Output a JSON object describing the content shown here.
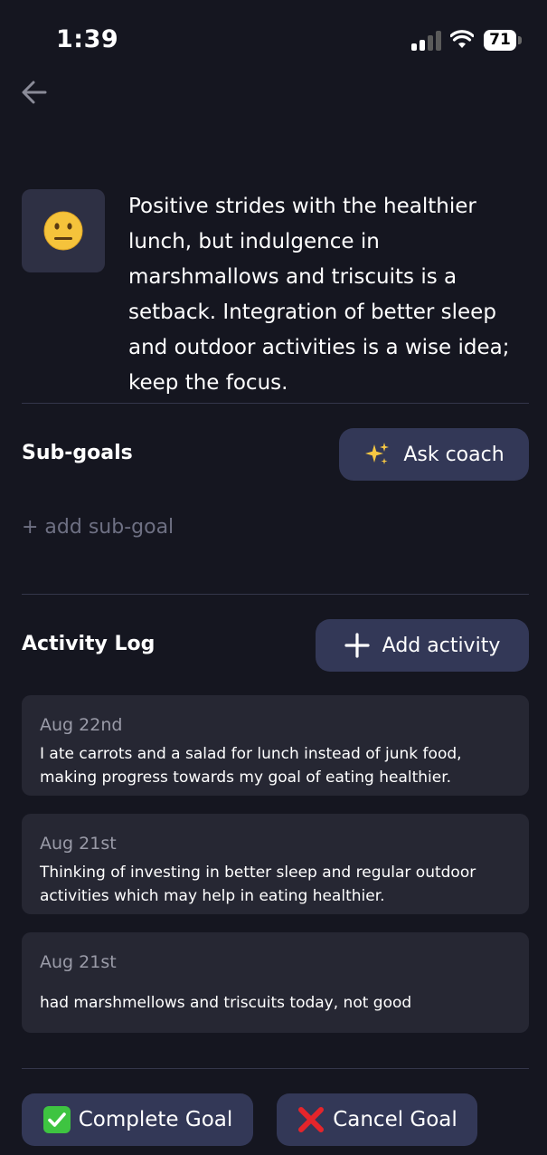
{
  "status_bar": {
    "time": "1:39",
    "battery": "71"
  },
  "summary": {
    "emoji": "neutral-face-icon",
    "text": "Positive strides with the healthier lunch, but indulgence in marshmallows and triscuits is a setback. Integration of better sleep and outdoor activities is a wise idea; keep the focus."
  },
  "subgoals": {
    "title": "Sub-goals",
    "ask_coach_label": "Ask coach",
    "add_label": "+ add sub-goal"
  },
  "activity_log": {
    "title": "Activity Log",
    "add_label": "Add activity",
    "entries": [
      {
        "date": "Aug 22nd",
        "text": "I ate carrots and a salad for lunch instead of junk food, making progress towards my goal of eating healthier."
      },
      {
        "date": "Aug 21st",
        "text": "Thinking of investing in better sleep and regular outdoor activities which may help in eating healthier."
      },
      {
        "date": "Aug 21st",
        "text": "had marshmellows and triscuits today, not good"
      }
    ]
  },
  "actions": {
    "complete_label": "Complete Goal",
    "cancel_label": "Cancel Goal"
  },
  "colors": {
    "background": "#151620",
    "card": "#262733",
    "button": "#333857",
    "complete_check": "#3ec441",
    "cancel_x": "#e5252b"
  }
}
